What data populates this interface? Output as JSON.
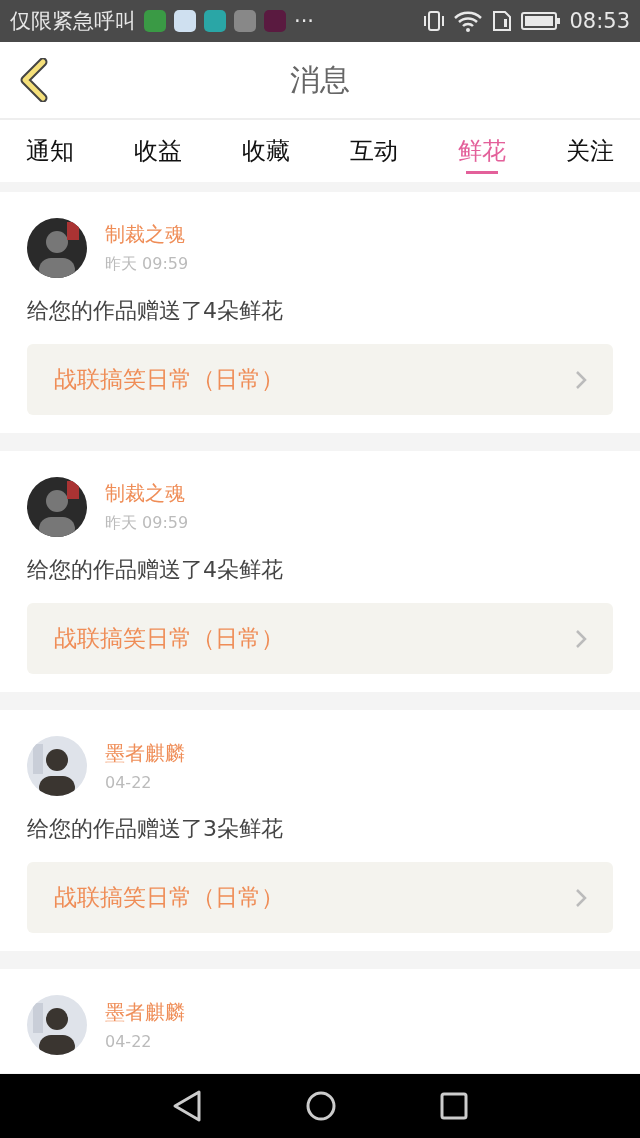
{
  "status_bar": {
    "carrier": "仅限紧急呼叫",
    "more": "···",
    "time": "08:53"
  },
  "header": {
    "title": "消息"
  },
  "tabs": [
    {
      "label": "通知",
      "selected": false
    },
    {
      "label": "收益",
      "selected": false
    },
    {
      "label": "收藏",
      "selected": false
    },
    {
      "label": "互动",
      "selected": false
    },
    {
      "label": "鲜花",
      "selected": true
    },
    {
      "label": "关注",
      "selected": false
    }
  ],
  "messages": [
    {
      "user": "制裁之魂",
      "time": "昨天 09:59",
      "text": "给您的作品赠送了4朵鲜花",
      "work": "战联搞笑日常（日常）"
    },
    {
      "user": "制裁之魂",
      "time": "昨天 09:59",
      "text": "给您的作品赠送了4朵鲜花",
      "work": "战联搞笑日常（日常）"
    },
    {
      "user": "墨者麒麟",
      "time": "04-22",
      "text": "给您的作品赠送了3朵鲜花",
      "work": "战联搞笑日常（日常）"
    },
    {
      "user": "墨者麒麟",
      "time": "04-22"
    }
  ]
}
